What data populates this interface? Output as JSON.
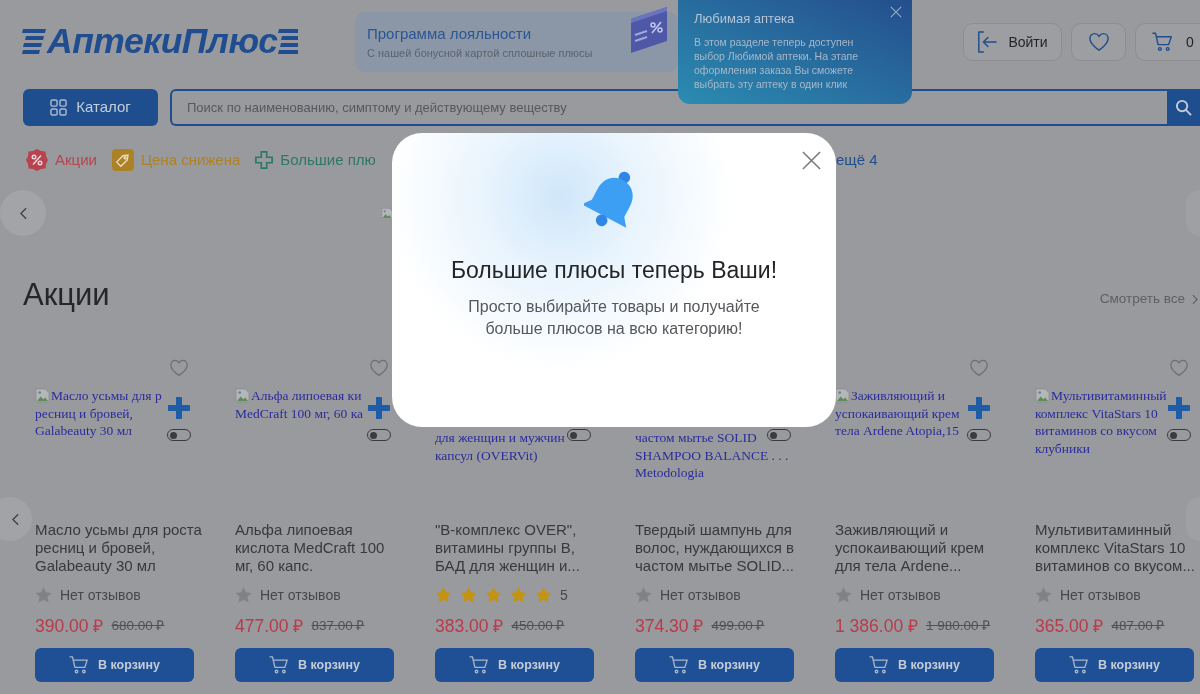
{
  "header": {
    "logo": "АптекиПлюс",
    "loyalty_banner": {
      "title": "Программа лояльности",
      "subtitle": "С нашей бонусной картой сплошные плюсы"
    },
    "login_button": "Войти",
    "cart_count": "0",
    "catalog_button": "Каталог",
    "search": {
      "placeholder": "Поиск по наименованию, симптому и действующему веществу"
    }
  },
  "tooltip": {
    "title": "Любимая аптека",
    "text": "В этом разделе теперь доступен выбор Любимой аптеки. На этапе оформления заказа Вы сможете выбрать эту аптеку в один клик"
  },
  "category_chips": [
    {
      "kind": "percent",
      "label": "Акции",
      "color": "#b8434f"
    },
    {
      "kind": "tag",
      "label": "Цена снижена",
      "color": "#ad8226"
    },
    {
      "kind": "cross",
      "label": "Большие плю",
      "color": "#2d7866"
    }
  ],
  "more_categories": "ещё 4",
  "section": {
    "title": "Акции",
    "see_all": "Смотреть все"
  },
  "products": [
    {
      "image_alt_lines": [
        "Масло усьмы для р",
        "ресниц и бровей,",
        "Galabeauty 30 мл"
      ],
      "switch_on": false,
      "name": "Масло усьмы для роста ресниц и бровей, Galabeauty 30 мл",
      "rating": {
        "kind": "none",
        "text": "Нет отзывов"
      },
      "price": "390.00 ₽",
      "old_price": "680.00 ₽",
      "cart_button": "В корзину"
    },
    {
      "image_alt_lines": [
        "Альфа липоевая ки",
        "MedCraft 100 мг, 60 ка"
      ],
      "switch_on": false,
      "name": "Альфа липоевая кислота MedCraft 100 мг, 60 капс.",
      "rating": {
        "kind": "none",
        "text": "Нет отзывов"
      },
      "price": "477.00 ₽",
      "old_price": "837.00 ₽",
      "cart_button": "В корзину"
    },
    {
      "image_alt_lines": [
        "для женщин и мужчин",
        "капсул (OVERVit)"
      ],
      "switch_on": false,
      "name": "\"В-комплекс OVER\", витамины группы В, БАД для женщин и...",
      "rating": {
        "kind": "stars",
        "stars": 5,
        "text": "5"
      },
      "price": "383.00 ₽",
      "old_price": "450.00 ₽",
      "cart_button": "В корзину"
    },
    {
      "image_alt_lines": [
        "частом мытье SOLID",
        "SHAMPOO BALANCE . . .",
        "Metodologia"
      ],
      "switch_on": false,
      "name": "Твердый шампунь для волос, нуждающихся в частом мытье SOLID...",
      "rating": {
        "kind": "none",
        "text": "Нет отзывов"
      },
      "price": "374.30 ₽",
      "old_price": "499.00 ₽",
      "cart_button": "В корзину"
    },
    {
      "image_alt_lines": [
        "Заживляющий и",
        "успокаивающий крем",
        "тела Ardene Atopia,15"
      ],
      "switch_on": false,
      "name": "Заживляющий и успокаивающий крем для тела Ardene...",
      "rating": {
        "kind": "none",
        "text": "Нет отзывов"
      },
      "price": "1 386.00 ₽",
      "old_price": "1 980.00 ₽",
      "cart_button": "В корзину"
    },
    {
      "image_alt_lines": [
        "Мультивитаминный",
        "комплекс VitaStars 10",
        "витаминов со вкусом",
        "клубники"
      ],
      "switch_on": false,
      "name": "Мультивитаминный комплекс VitaStars 10 витаминов со вкусом...",
      "rating": {
        "kind": "none",
        "text": "Нет отзывов"
      },
      "price": "365.00 ₽",
      "old_price": "487.00 ₽",
      "cart_button": "В корзину"
    }
  ],
  "modal": {
    "title": "Большие плюсы теперь Ваши!",
    "text": "Просто выбирайте товары и получайте больше плюсов на всю категорию!"
  }
}
